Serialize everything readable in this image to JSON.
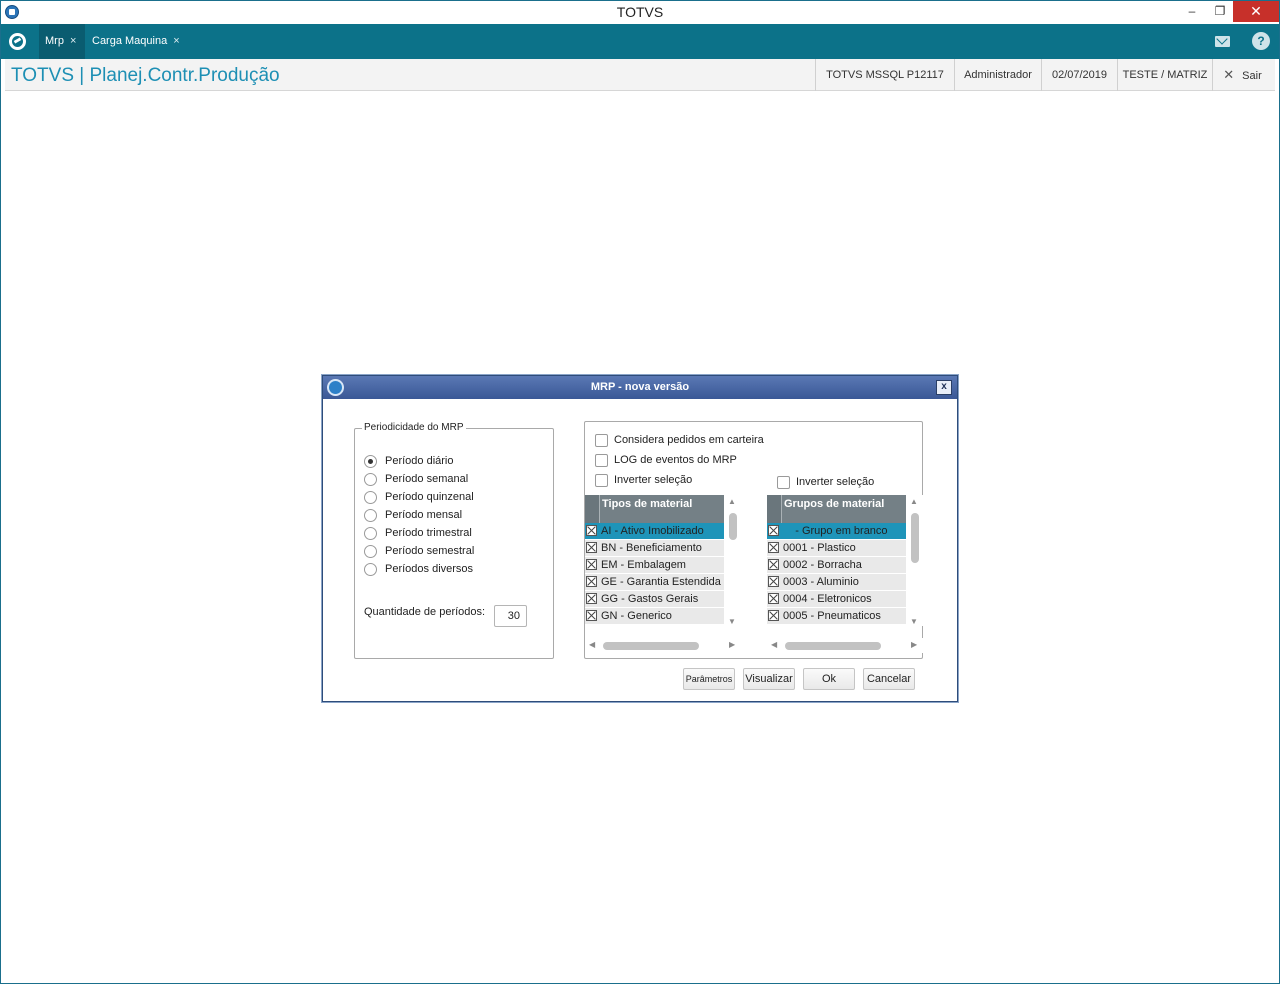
{
  "window": {
    "title": "TOTVS",
    "controls": {
      "minimize": "–",
      "maximize": "❐",
      "close": "✕"
    }
  },
  "tabs": [
    {
      "label": "Mrp",
      "close": "×",
      "active": true
    },
    {
      "label": "Carga Maquina",
      "close": "×",
      "active": false
    }
  ],
  "header": {
    "app_title": "TOTVS | Planej.Contr.Produção",
    "environment": "TOTVS  MSSQL P12117",
    "user": "Administrador",
    "date": "02/07/2019",
    "company": "TESTE / MATRIZ",
    "exit_icon": "✕",
    "exit_label": "Sair"
  },
  "dialog": {
    "title": "MRP - nova versão",
    "close": "x",
    "periodicity": {
      "legend": "Periodicidade do MRP",
      "options": [
        {
          "label": "Período diário",
          "checked": true
        },
        {
          "label": "Período semanal",
          "checked": false
        },
        {
          "label": "Período quinzenal",
          "checked": false
        },
        {
          "label": "Período mensal",
          "checked": false
        },
        {
          "label": "Período trimestral",
          "checked": false
        },
        {
          "label": "Período semestral",
          "checked": false
        },
        {
          "label": "Períodos diversos",
          "checked": false
        }
      ],
      "quantity_label": "Quantidade de períodos:",
      "quantity_value": "30"
    },
    "options": {
      "considera_pedidos": "Considera pedidos em carteira",
      "log_eventos": "LOG de eventos do MRP",
      "inverter_left": "Inverter seleção",
      "inverter_right": "Inverter seleção"
    },
    "tipos_material": {
      "header": "Tipos de material",
      "rows": [
        {
          "text": "AI - Ativo Imobilizado",
          "selected": true
        },
        {
          "text": "BN - Beneficiamento",
          "selected": false
        },
        {
          "text": "EM - Embalagem",
          "selected": false
        },
        {
          "text": "GE - Garantia Estendida",
          "selected": false
        },
        {
          "text": "GG - Gastos Gerais",
          "selected": false
        },
        {
          "text": "GN - Generico",
          "selected": false
        }
      ]
    },
    "grupos_material": {
      "header": "Grupos de material",
      "rows": [
        {
          "text": "    - Grupo em branco",
          "selected": true
        },
        {
          "text": "0001 - Plastico",
          "selected": false
        },
        {
          "text": "0002 - Borracha",
          "selected": false
        },
        {
          "text": "0003 - Aluminio",
          "selected": false
        },
        {
          "text": "0004 - Eletronicos",
          "selected": false
        },
        {
          "text": "0005 - Pneumaticos",
          "selected": false
        }
      ]
    },
    "buttons": {
      "parametros": "Parâmetros",
      "visualizar": "Visualizar",
      "ok": "Ok",
      "cancelar": "Cancelar"
    }
  },
  "colors": {
    "tabbar": "#0c7289",
    "accent_title": "#1d8fb4",
    "selection": "#1e94b9",
    "dialog_title": "#3a5896"
  }
}
